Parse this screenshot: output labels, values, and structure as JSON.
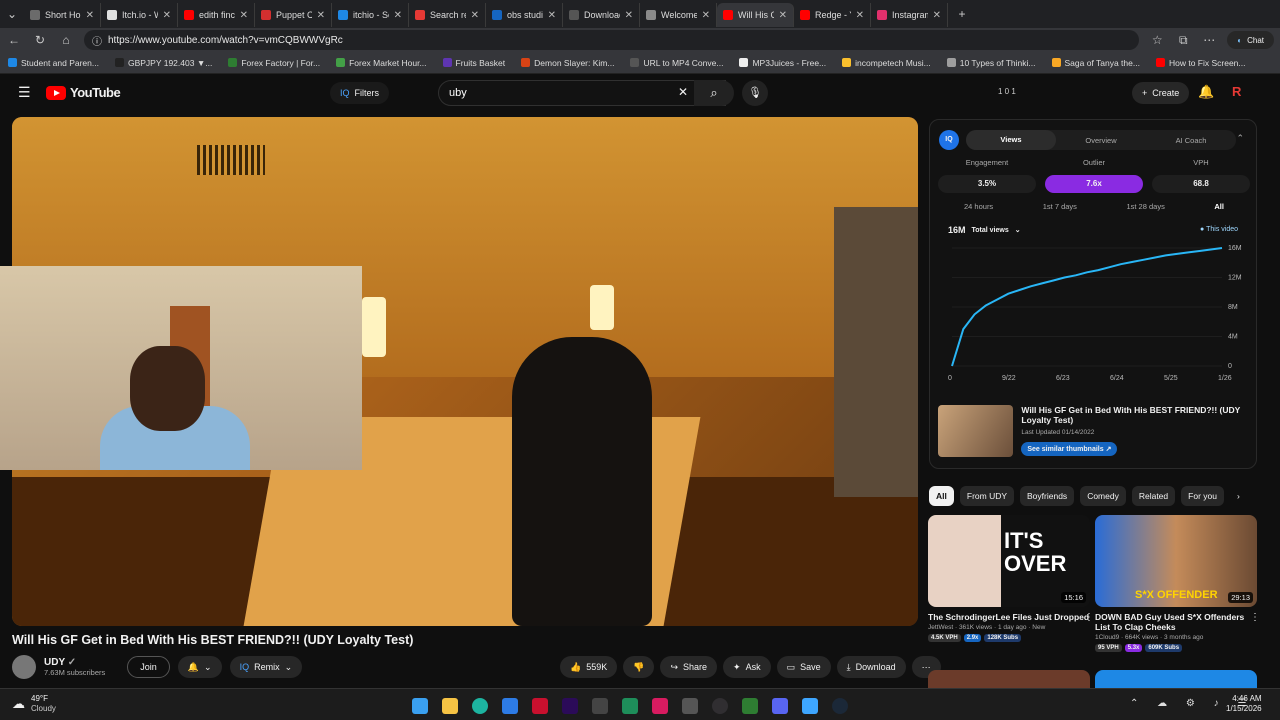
{
  "browser": {
    "tabs": [
      {
        "label": "Short Horror Ga",
        "color": "#6b6b6b"
      },
      {
        "label": "Itch.io - Wikipe",
        "color": "#e0e0e0"
      },
      {
        "label": "edith finch - Yo",
        "color": "#ff0000"
      },
      {
        "label": "Puppet Combo",
        "color": "#d32f2f"
      },
      {
        "label": "itchio - Search",
        "color": "#1e88e5"
      },
      {
        "label": "Search results f",
        "color": "#e53935"
      },
      {
        "label": "obs studio - Se",
        "color": "#1565c0"
      },
      {
        "label": "Download | OB",
        "color": "#555555"
      },
      {
        "label": "Welcome | OBS",
        "color": "#8a8a8a"
      },
      {
        "label": "Will His GF Get",
        "color": "#ff0000"
      },
      {
        "label": "Redge - YouTub",
        "color": "#ff0000"
      },
      {
        "label": "Instagram",
        "color": "#e1306c"
      }
    ],
    "url": "https://www.youtube.com/watch?v=vmCQBWWVgRc",
    "bookmarks": [
      {
        "label": "Student and Paren...",
        "color": "#1e88e5"
      },
      {
        "label": "GBPJPY 192.403 ▼...",
        "color": "#222222"
      },
      {
        "label": "Forex Factory | For...",
        "color": "#2e7d32"
      },
      {
        "label": "Forex Market Hour...",
        "color": "#43a047"
      },
      {
        "label": "Fruits Basket",
        "color": "#5e35b1"
      },
      {
        "label": "Demon Slayer: Kim...",
        "color": "#d84315"
      },
      {
        "label": "URL to MP4 Conve...",
        "color": "#555555"
      },
      {
        "label": "MP3Juices - Free...",
        "color": "#eeeeee"
      },
      {
        "label": "incompetech Musi...",
        "color": "#fbc02d"
      },
      {
        "label": "10 Types of Thinki...",
        "color": "#9e9e9e"
      },
      {
        "label": "Saga of Tanya the...",
        "color": "#f9a825"
      },
      {
        "label": "How to Fix Screen...",
        "color": "#ff0000"
      }
    ],
    "chat_label": "Chat"
  },
  "yt": {
    "logo": "YouTube",
    "filters_label": "Filters",
    "search_value": "uby",
    "counters": "1  0  1",
    "create_label": "Create",
    "video_title": "Will His GF Get in Bed With His BEST FRIEND?!! (UDY Loyalty Test)",
    "channel_name": "UDY",
    "subscribers": "7.63M subscribers",
    "join_label": "Join",
    "remix_label": "Remix",
    "likes": "559K",
    "share_label": "Share",
    "ask_label": "Ask",
    "save_label": "Save",
    "download_label": "Download"
  },
  "panel": {
    "tabs": [
      "Views",
      "Overview",
      "AI Coach"
    ],
    "metric_labels": [
      "Engagement",
      "Outlier",
      "VPH"
    ],
    "metric_values": [
      "3.5%",
      "7.6x",
      "68.8"
    ],
    "ranges": [
      "24 hours",
      "1st 7 days",
      "1st 28 days",
      "All"
    ],
    "total_value": "16M",
    "total_label": "Total views",
    "legend": "This video",
    "video_title": "Will His GF Get in Bed With His BEST FRIEND?!! (UDY Loyalty Test)",
    "last_updated": "Last Updated 01/14/2022",
    "similar_label": "See similar thumbnails"
  },
  "chart_data": {
    "type": "line",
    "x_ticks": [
      "0",
      "9/22",
      "6/23",
      "6/24",
      "5/25",
      "1/26"
    ],
    "y_ticks": [
      "0",
      "4M",
      "8M",
      "12M",
      "16M"
    ],
    "ylim": [
      0,
      16
    ],
    "series": [
      {
        "name": "This video",
        "values": [
          0,
          5,
          7,
          8.2,
          9,
          9.8,
          10.3,
          10.8,
          11.2,
          11.6,
          12,
          12.3,
          12.7,
          13,
          13.4,
          13.8,
          14.1,
          14.4,
          14.7,
          15,
          15.2,
          15.4,
          15.6,
          15.8,
          16
        ]
      }
    ]
  },
  "chips": [
    "All",
    "From UDY",
    "Boyfriends",
    "Comedy",
    "Related",
    "For you"
  ],
  "recommendations": [
    {
      "title": "The SchrodingerLee Files Just Dropped",
      "meta": "JettWest · 361K views · 1 day ago · New",
      "duration": "15:16",
      "badges": [
        "4.5K VPH",
        "2.9x",
        "128K Subs"
      ],
      "thumb_text": "IT'S OVER"
    },
    {
      "title": "DOWN BAD Guy Used S*X Offenders List To Clap Cheeks",
      "meta": "1Cloud9 · 664K views · 3 months ago",
      "duration": "29:13",
      "badges": [
        "95 VPH",
        "5.3x",
        "609K Subs"
      ],
      "thumb_text": "S*X OFFENDER"
    }
  ],
  "weather": {
    "temp": "49°F",
    "condition": "Cloudy"
  },
  "clock": {
    "time": "4:46 AM",
    "date": "1/15/2026"
  }
}
